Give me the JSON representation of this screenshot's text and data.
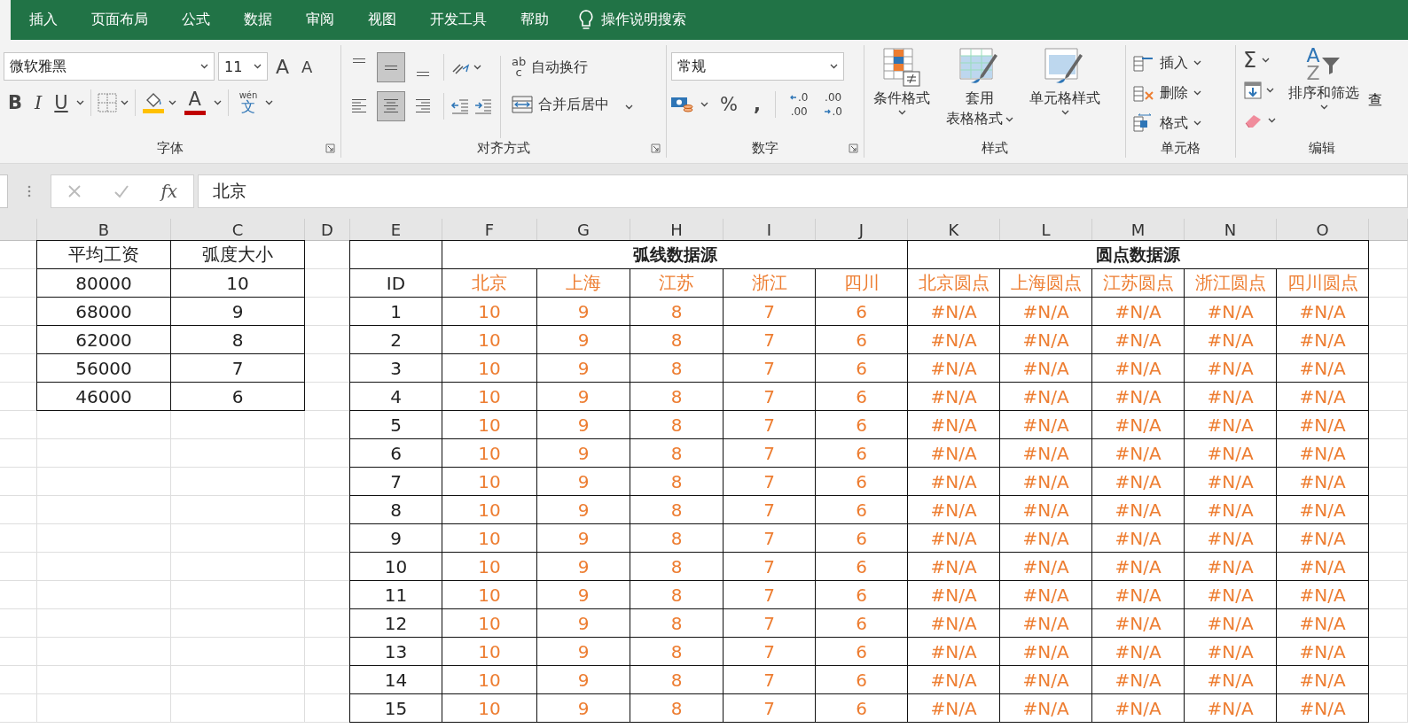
{
  "ribbon_tabs": [
    {
      "label": "插入"
    },
    {
      "label": "页面布局"
    },
    {
      "label": "公式"
    },
    {
      "label": "数据"
    },
    {
      "label": "审阅"
    },
    {
      "label": "视图"
    },
    {
      "label": "开发工具"
    },
    {
      "label": "帮助"
    }
  ],
  "tell_me": "操作说明搜索",
  "ribbon": {
    "font": {
      "name": "微软雅黑",
      "size": "11",
      "grow": "A",
      "shrink": "A",
      "bold": "B",
      "italic": "I",
      "underline": "U",
      "color_letter": "A",
      "ruby": "wén",
      "ruby_base": "文",
      "label": "字体"
    },
    "alignment": {
      "vertical": [
        {
          "selected": false
        },
        {
          "selected": true
        },
        {
          "selected": false
        }
      ],
      "horizontal": [
        {
          "selected": false
        },
        {
          "selected": true
        },
        {
          "selected": false
        }
      ],
      "wrap_icon": [
        "ab",
        "c"
      ],
      "wrap": "自动换行",
      "merge": "合并后居中",
      "label": "对齐方式"
    },
    "number": {
      "format": "常规",
      "percent": "%",
      "comma": ",",
      "increase": [
        ".0",
        ".00"
      ],
      "decrease": [
        ".00",
        ".0"
      ],
      "label": "数字"
    },
    "styles": {
      "buttons": [
        {
          "lines": [
            "条件格式"
          ]
        },
        {
          "lines": [
            "套用",
            "表格格式"
          ]
        },
        {
          "lines": [
            "单元格样式"
          ]
        }
      ],
      "label": "样式"
    },
    "cells": {
      "buttons": [
        "插入",
        "删除",
        "格式"
      ],
      "label": "单元格"
    },
    "editing": {
      "sum": "Σ",
      "sort_letters": [
        "A",
        "Z"
      ],
      "sort": "排序和筛选",
      "find": "查",
      "label": "编辑"
    }
  },
  "formula_bar": {
    "function_label": "fx",
    "value": "北京"
  },
  "sheet": {
    "columns": [
      "B",
      "C",
      "D",
      "E",
      "F",
      "G",
      "H",
      "I",
      "J",
      "K",
      "L",
      "M",
      "N",
      "O"
    ],
    "left_table": {
      "headers": [
        "平均工资",
        "弧度大小"
      ],
      "rows": [
        [
          "80000",
          "10"
        ],
        [
          "68000",
          "9"
        ],
        [
          "62000",
          "8"
        ],
        [
          "56000",
          "7"
        ],
        [
          "46000",
          "6"
        ]
      ]
    },
    "right_table": {
      "groups": [
        "弧线数据源",
        "圆点数据源"
      ],
      "id_header": "ID",
      "headers": [
        "北京",
        "上海",
        "江苏",
        "浙江",
        "四川",
        "北京圆点",
        "上海圆点",
        "江苏圆点",
        "浙江圆点",
        "四川圆点"
      ],
      "rows": [
        {
          "id": "1",
          "values": [
            "10",
            "9",
            "8",
            "7",
            "6",
            "#N/A",
            "#N/A",
            "#N/A",
            "#N/A",
            "#N/A"
          ]
        },
        {
          "id": "2",
          "values": [
            "10",
            "9",
            "8",
            "7",
            "6",
            "#N/A",
            "#N/A",
            "#N/A",
            "#N/A",
            "#N/A"
          ]
        },
        {
          "id": "3",
          "values": [
            "10",
            "9",
            "8",
            "7",
            "6",
            "#N/A",
            "#N/A",
            "#N/A",
            "#N/A",
            "#N/A"
          ]
        },
        {
          "id": "4",
          "values": [
            "10",
            "9",
            "8",
            "7",
            "6",
            "#N/A",
            "#N/A",
            "#N/A",
            "#N/A",
            "#N/A"
          ]
        },
        {
          "id": "5",
          "values": [
            "10",
            "9",
            "8",
            "7",
            "6",
            "#N/A",
            "#N/A",
            "#N/A",
            "#N/A",
            "#N/A"
          ]
        },
        {
          "id": "6",
          "values": [
            "10",
            "9",
            "8",
            "7",
            "6",
            "#N/A",
            "#N/A",
            "#N/A",
            "#N/A",
            "#N/A"
          ]
        },
        {
          "id": "7",
          "values": [
            "10",
            "9",
            "8",
            "7",
            "6",
            "#N/A",
            "#N/A",
            "#N/A",
            "#N/A",
            "#N/A"
          ]
        },
        {
          "id": "8",
          "values": [
            "10",
            "9",
            "8",
            "7",
            "6",
            "#N/A",
            "#N/A",
            "#N/A",
            "#N/A",
            "#N/A"
          ]
        },
        {
          "id": "9",
          "values": [
            "10",
            "9",
            "8",
            "7",
            "6",
            "#N/A",
            "#N/A",
            "#N/A",
            "#N/A",
            "#N/A"
          ]
        },
        {
          "id": "10",
          "values": [
            "10",
            "9",
            "8",
            "7",
            "6",
            "#N/A",
            "#N/A",
            "#N/A",
            "#N/A",
            "#N/A"
          ]
        },
        {
          "id": "11",
          "values": [
            "10",
            "9",
            "8",
            "7",
            "6",
            "#N/A",
            "#N/A",
            "#N/A",
            "#N/A",
            "#N/A"
          ]
        },
        {
          "id": "12",
          "values": [
            "10",
            "9",
            "8",
            "7",
            "6",
            "#N/A",
            "#N/A",
            "#N/A",
            "#N/A",
            "#N/A"
          ]
        },
        {
          "id": "13",
          "values": [
            "10",
            "9",
            "8",
            "7",
            "6",
            "#N/A",
            "#N/A",
            "#N/A",
            "#N/A",
            "#N/A"
          ]
        },
        {
          "id": "14",
          "values": [
            "10",
            "9",
            "8",
            "7",
            "6",
            "#N/A",
            "#N/A",
            "#N/A",
            "#N/A",
            "#N/A"
          ]
        },
        {
          "id": "15",
          "values": [
            "10",
            "9",
            "8",
            "7",
            "6",
            "#N/A",
            "#N/A",
            "#N/A",
            "#N/A",
            "#N/A"
          ]
        }
      ]
    }
  }
}
